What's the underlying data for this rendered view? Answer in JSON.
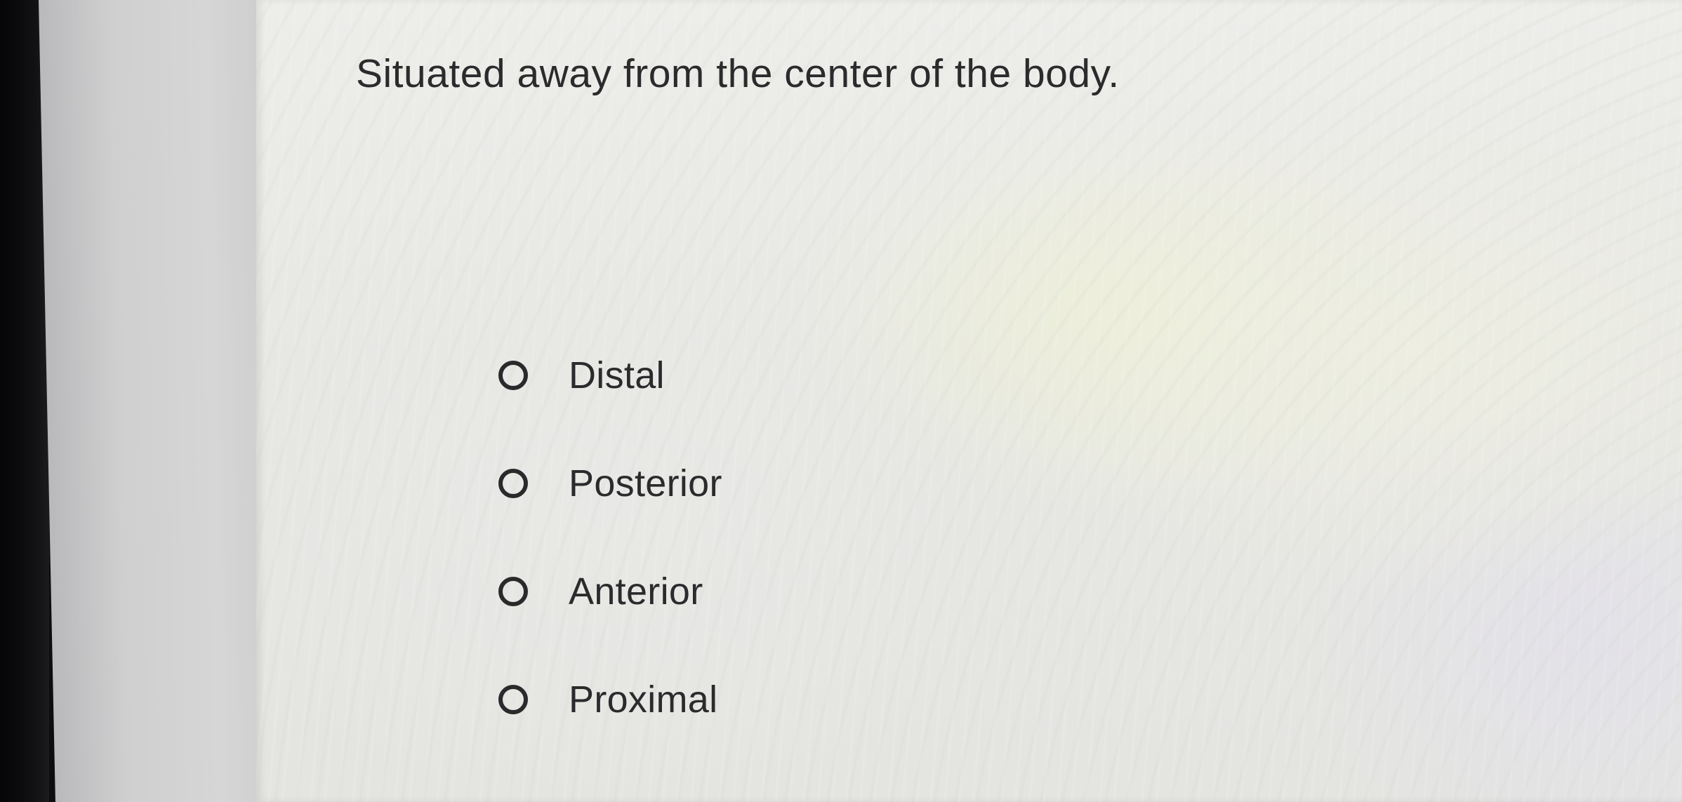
{
  "question": {
    "text": "Situated away from the center of the body."
  },
  "options": [
    {
      "label": "Distal",
      "selected": false
    },
    {
      "label": "Posterior",
      "selected": false
    },
    {
      "label": "Anterior",
      "selected": false
    },
    {
      "label": "Proximal",
      "selected": false
    }
  ]
}
